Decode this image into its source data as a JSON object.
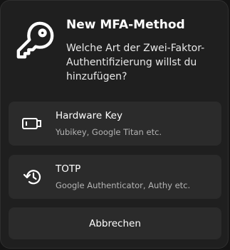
{
  "dialog": {
    "title": "New MFA-Method",
    "description": "Welche Art der Zwei-Faktor-Authentifizierung willst du hinzufügen?",
    "header_icon": "key-icon"
  },
  "options": [
    {
      "label": "Hardware Key",
      "subtitle": "Yubikey, Google Titan etc.",
      "icon": "hardware-key-icon"
    },
    {
      "label": "TOTP",
      "subtitle": "Google Authenticator, Authy etc.",
      "icon": "history-icon"
    }
  ],
  "cancel_label": "Abbrechen"
}
